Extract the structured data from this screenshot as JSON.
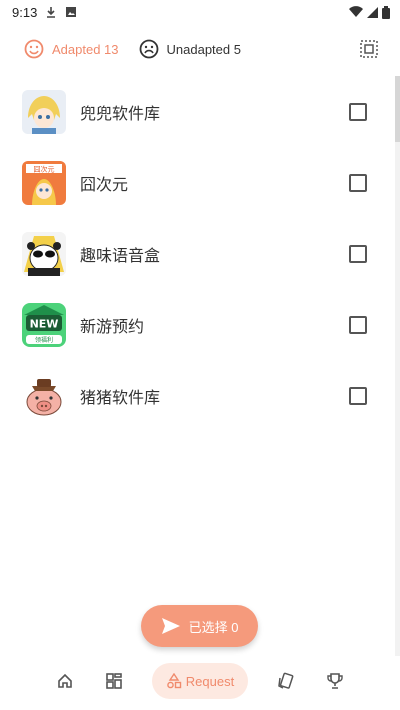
{
  "status": {
    "time": "9:13"
  },
  "tabs": {
    "adapted_label": "Adapted 13",
    "unadapted_label": "Unadapted 5"
  },
  "apps": [
    {
      "name": "兜兜软件库"
    },
    {
      "name": "囧次元"
    },
    {
      "name": "趣味语音盒"
    },
    {
      "name": "新游预约"
    },
    {
      "name": "猪猪软件库"
    }
  ],
  "fab": {
    "label": "已选择 0"
  },
  "nav": {
    "request_label": "Request"
  },
  "colors": {
    "accent": "#f08a6c",
    "fab": "#f59a7c",
    "nav_active_bg": "#fde9e1"
  }
}
